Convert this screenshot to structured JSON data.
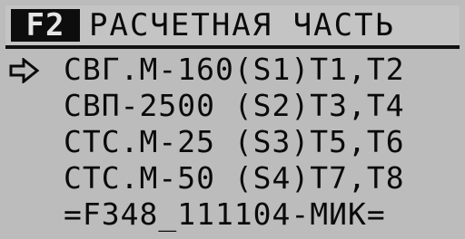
{
  "header": {
    "fkey_label": "F2",
    "title": "РАСЧЕТНАЯ ЧАСТЬ"
  },
  "menu": {
    "pointer_icon": "arrow-right-outline-icon",
    "selected_index": 0,
    "items": [
      {
        "label": "СВГ.М-160(S1)T1,T2"
      },
      {
        "label": "СВП-2500 (S2)T3,T4"
      },
      {
        "label": "СТС.М-25 (S3)T5,T6"
      },
      {
        "label": "СТС.М-50 (S4)T7,T8"
      },
      {
        "label": "=F348_111104-МИК="
      }
    ]
  },
  "colors": {
    "screen_bg": "#bcbcbc",
    "text": "#0a0a0a",
    "fkey_bg": "#0d0d0d",
    "fkey_text": "#e6e6e6"
  }
}
